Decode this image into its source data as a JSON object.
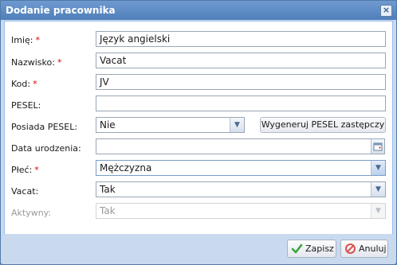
{
  "window": {
    "title": "Dodanie pracownika",
    "close_icon": "close-icon"
  },
  "form": {
    "imie": {
      "label": "Imię:",
      "required": "*",
      "value": "Język angielski"
    },
    "nazwisko": {
      "label": "Nazwisko:",
      "required": "*",
      "value": "Vacat"
    },
    "kod": {
      "label": "Kod:",
      "required": "*",
      "value": "JV"
    },
    "pesel": {
      "label": "PESEL:",
      "value": ""
    },
    "posiada_pesel": {
      "label": "Posiada PESEL:",
      "value": "Nie"
    },
    "generate_button": "Wygeneruj PESEL zastępczy",
    "data_urodzenia": {
      "label": "Data urodzenia:",
      "value": ""
    },
    "plec": {
      "label": "Płeć:",
      "required": "*",
      "value": "Mężczyzna"
    },
    "vacat": {
      "label": "Vacat:",
      "value": "Tak"
    },
    "aktywny": {
      "label": "Aktywny:",
      "value": "Tak"
    }
  },
  "footer": {
    "save_label": "Zapisz",
    "cancel_label": "Anuluj"
  },
  "colors": {
    "required": "#e00000",
    "save_check": "#3aa53a",
    "cancel_icon": "#d9534f"
  }
}
